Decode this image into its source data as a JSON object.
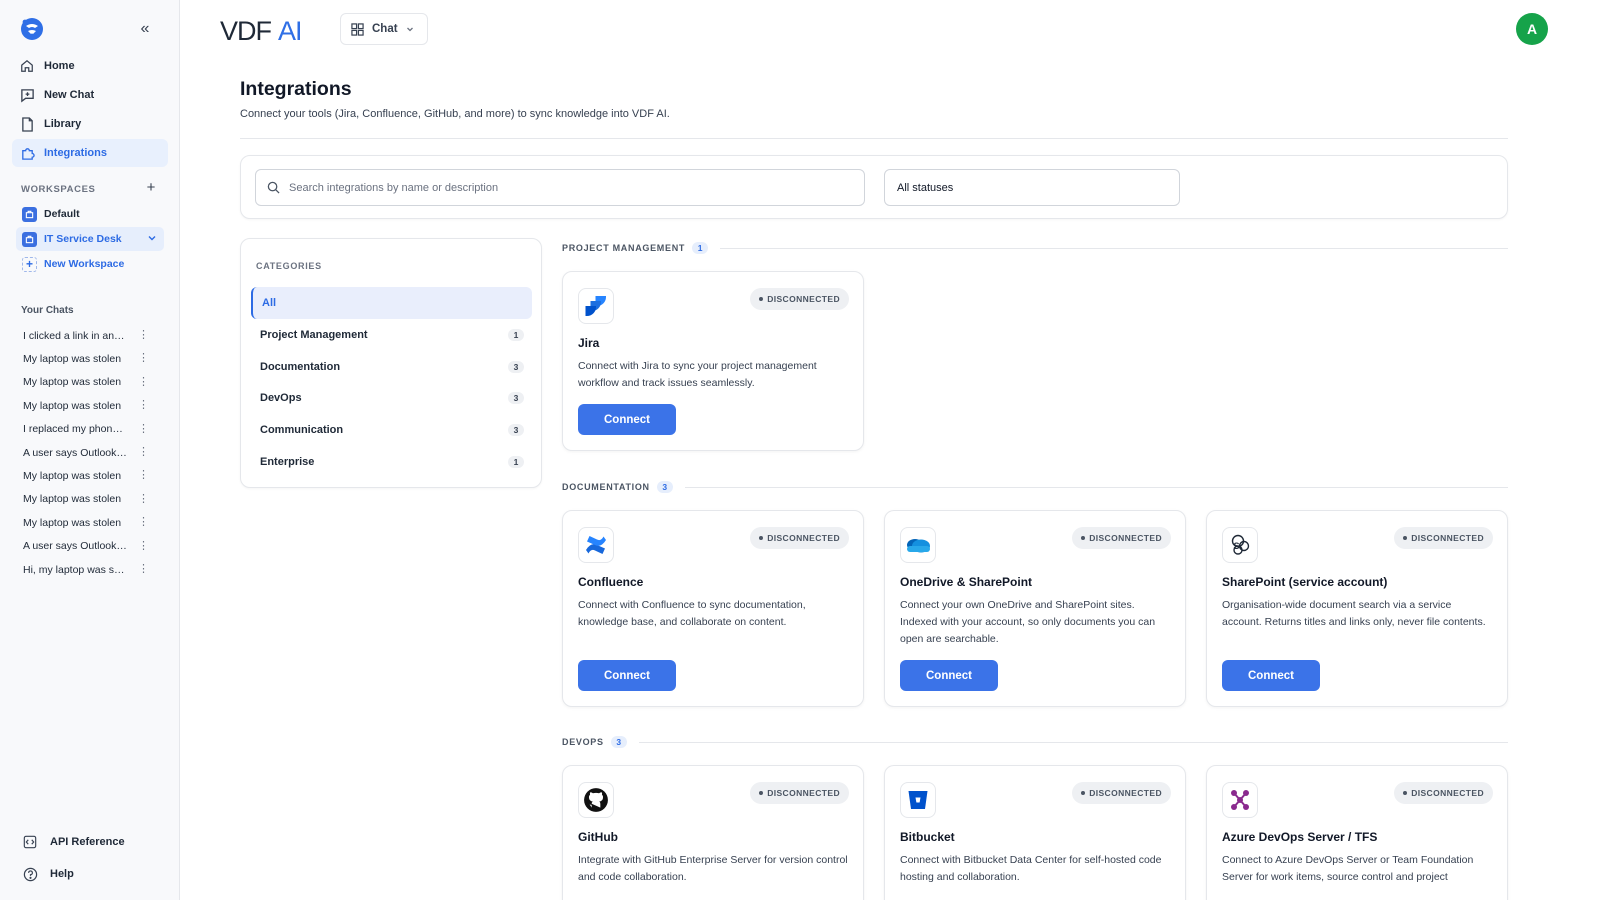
{
  "app": {
    "wordmark": "VDFAI",
    "avatar_initial": "A",
    "view_selector": "Chat"
  },
  "sidebar": {
    "nav": [
      {
        "label": "Home",
        "icon": "home-icon"
      },
      {
        "label": "New Chat",
        "icon": "new-chat-icon"
      },
      {
        "label": "Library",
        "icon": "document-icon"
      },
      {
        "label": "Integrations",
        "icon": "puzzle-icon",
        "active": true
      }
    ],
    "workspaces_label": "WORKSPACES",
    "workspaces": [
      {
        "label": "Default"
      },
      {
        "label": "IT Service Desk",
        "active": true
      },
      {
        "label": "New Workspace"
      }
    ],
    "chats_label": "Your Chats",
    "chats": [
      "I clicked a link in an email",
      "My laptop was stolen",
      "My laptop was stolen",
      "My laptop was stolen",
      "I replaced my phone and",
      "A user says Outlook keeps",
      "My laptop was stolen",
      "My laptop was stolen",
      "My laptop was stolen",
      "A user says Outlook keeps",
      "Hi, my laptop was stolen"
    ],
    "bottom": [
      {
        "label": "API Reference",
        "icon": "api-icon"
      },
      {
        "label": "Help",
        "icon": "help-icon"
      }
    ]
  },
  "page": {
    "title": "Integrations",
    "subtitle": "Connect your tools (Jira, Confluence, GitHub, and more) to sync knowledge into VDF AI."
  },
  "filters": {
    "search_placeholder": "Search integrations by name or description",
    "status_value": "All statuses"
  },
  "categories": {
    "label": "CATEGORIES",
    "items": [
      {
        "label": "All",
        "count": ""
      },
      {
        "label": "Project Management",
        "count": "1"
      },
      {
        "label": "Documentation",
        "count": "3"
      },
      {
        "label": "DevOps",
        "count": "3"
      },
      {
        "label": "Communication",
        "count": "3"
      },
      {
        "label": "Enterprise",
        "count": "1"
      }
    ]
  },
  "sections": {
    "project_management": {
      "label": "PROJECT MANAGEMENT",
      "count": "1",
      "cards": [
        {
          "name": "Jira",
          "status": "DISCONNECTED",
          "button": "Connect",
          "icon": "jira-icon",
          "desc": "Connect with Jira to sync your project management workflow and track issues seamlessly."
        }
      ]
    },
    "documentation": {
      "label": "DOCUMENTATION",
      "count": "3",
      "cards": [
        {
          "name": "Confluence",
          "status": "DISCONNECTED",
          "button": "Connect",
          "icon": "confluence-icon",
          "desc": "Connect with Confluence to sync documentation, knowledge base, and collaborate on content."
        },
        {
          "name": "OneDrive & SharePoint",
          "status": "DISCONNECTED",
          "button": "Connect",
          "icon": "onedrive-icon",
          "desc": "Connect your own OneDrive and SharePoint sites. Indexed with your account, so only documents you can open are searchable."
        },
        {
          "name": "SharePoint (service account)",
          "status": "DISCONNECTED",
          "button": "Connect",
          "icon": "sharepoint-icon",
          "desc": "Organisation-wide document search via a service account. Returns titles and links only, never file contents."
        }
      ]
    },
    "devops": {
      "label": "DEVOPS",
      "count": "3",
      "cards": [
        {
          "name": "GitHub",
          "status": "DISCONNECTED",
          "icon": "github-icon",
          "desc": "Integrate with GitHub Enterprise Server for version control and code collaboration."
        },
        {
          "name": "Bitbucket",
          "status": "DISCONNECTED",
          "icon": "bitbucket-icon",
          "desc": "Connect with Bitbucket Data Center for self-hosted code hosting and collaboration."
        },
        {
          "name": "Azure DevOps Server / TFS",
          "status": "DISCONNECTED",
          "icon": "azure-devops-icon",
          "desc": "Connect to Azure DevOps Server or Team Foundation Server for work items, source control and project"
        }
      ]
    }
  },
  "colors": {
    "accent": "#3b73e8",
    "avatar": "#16a34a",
    "active_bg": "#e8f0fd"
  }
}
